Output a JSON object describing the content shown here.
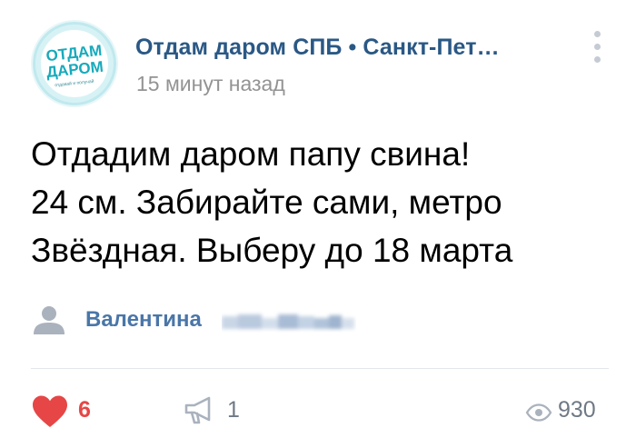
{
  "group": {
    "name": "Отдам даром СПБ • Санкт-Пет…",
    "time": "15 минут назад",
    "avatar": {
      "line1": "ОТДАМ",
      "line2": "ДАРОМ",
      "line3": "отдавай и получай",
      "accent_color": "#19b5c6"
    }
  },
  "post": {
    "text_lines": [
      "Отдадим даром папу свина!",
      "24 см. Забирайте сами, метро",
      "Звёздная. Выберу до 18 марта"
    ]
  },
  "author": {
    "first_name": "Валентина",
    "surname_hidden": true,
    "icon": "user-icon"
  },
  "footer": {
    "likes": "6",
    "like_icon": "heart-icon",
    "like_color": "#e64646",
    "shares": "1",
    "share_icon": "megaphone-icon",
    "views": "930",
    "views_icon": "eye-icon"
  },
  "colors": {
    "link": "#2a5885",
    "author": "#4a76a8",
    "muted": "#939393",
    "icon_gray": "#aab2bd"
  }
}
